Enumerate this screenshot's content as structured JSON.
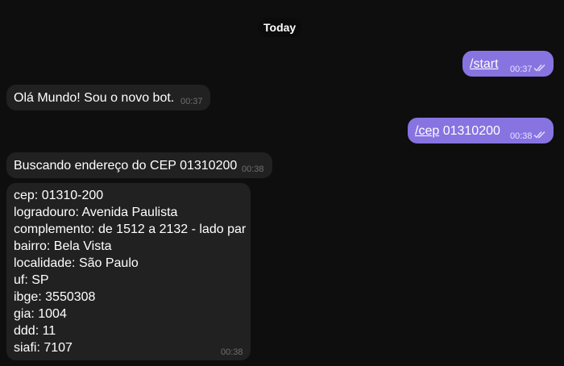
{
  "date_separator": "Today",
  "messages": [
    {
      "command": "/start",
      "text": "",
      "time": "00:37"
    },
    {
      "text": "Olá Mundo! Sou o novo bot.",
      "time": "00:37"
    },
    {
      "command": "/cep",
      "text": " 01310200",
      "time": "00:38"
    },
    {
      "text": "Buscando endereço do CEP 01310200",
      "time": "00:38"
    },
    {
      "lines": [
        "cep: 01310-200",
        "logradouro: Avenida Paulista",
        "complemento: de 1512 a 2132 - lado par",
        "bairro: Bela Vista",
        "localidade: São Paulo",
        "uf: SP",
        "ibge: 3550308",
        "gia: 1004",
        "ddd: 11",
        "siafi: 7107"
      ],
      "time": "00:38"
    }
  ],
  "colors": {
    "background": "#0e0e0e",
    "incoming_bubble": "#212121",
    "outgoing_bubble": "#8774e1"
  },
  "icons": {
    "read_receipt": "double-check-icon"
  }
}
